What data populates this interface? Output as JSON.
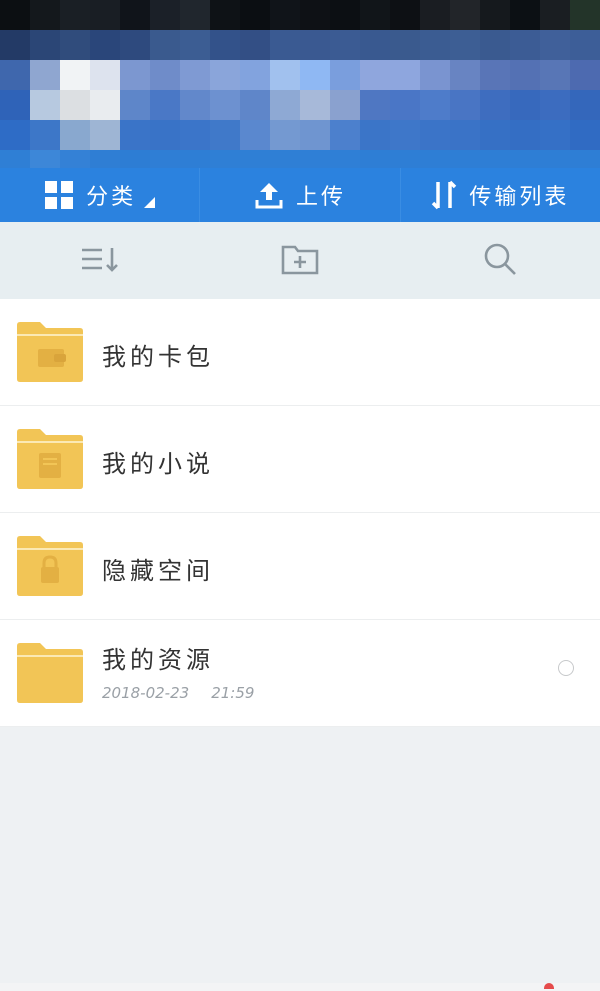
{
  "colors": {
    "accent": "#2b82df",
    "folder": "#f2c556",
    "toolbar_bg": "#e7eef1",
    "icon_gray": "#8a969e"
  },
  "topbar": {
    "items": [
      {
        "label": "分类",
        "icon": "grid-icon"
      },
      {
        "label": "上传",
        "icon": "upload-icon"
      },
      {
        "label": "传输列表",
        "icon": "transfer-icon"
      }
    ]
  },
  "toolbar2": {
    "items": [
      {
        "icon": "sort-icon"
      },
      {
        "icon": "new-folder-icon"
      },
      {
        "icon": "search-icon"
      }
    ]
  },
  "files": [
    {
      "name": "我的卡包",
      "icon": "wallet-folder-icon"
    },
    {
      "name": "我的小说",
      "icon": "book-folder-icon"
    },
    {
      "name": "隐藏空间",
      "icon": "lock-folder-icon"
    },
    {
      "name": "我的资源",
      "icon": "folder-icon",
      "date": "2018-02-23",
      "time": "21:59"
    }
  ]
}
